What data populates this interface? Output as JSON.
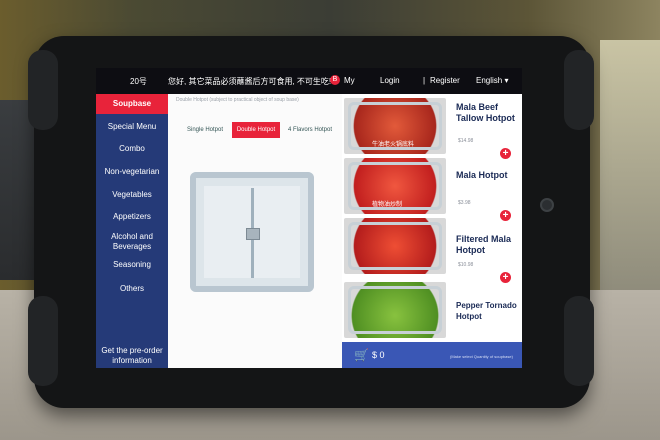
{
  "topbar": {
    "table_no": "20号",
    "notice": "您好, 其它菜品必须蘸酱后方可食用,  不可生吃!",
    "brand_letter": "B",
    "my": "My",
    "login": "Login",
    "separator": "|",
    "register": "Register",
    "language": "English ▾"
  },
  "sidebar": {
    "items": [
      {
        "label": "Soupbase"
      },
      {
        "label": "Special Menu"
      },
      {
        "label": "Combo"
      },
      {
        "label": "Non-vegetarian"
      },
      {
        "label": "Vegetables"
      },
      {
        "label": "Appetizers"
      },
      {
        "label": "Alcohol and Beverages"
      },
      {
        "label": "Seasoning"
      },
      {
        "label": "Others"
      },
      {
        "label": "Get the pre-order information"
      }
    ],
    "active_index": 0
  },
  "main": {
    "notice": "Double Hotpot (subject to practical object of soup base)",
    "tabs": [
      {
        "label": "Single Hotpot"
      },
      {
        "label": "Double Hotpot"
      },
      {
        "label": "4 Flavors Hotpot"
      }
    ],
    "active_tab": 1
  },
  "menu": {
    "items": [
      {
        "name": "Mala Beef Tallow Hotpot",
        "price": "$14.98",
        "caption": "牛油老火锅底料"
      },
      {
        "name": "Mala Hotpot",
        "price": "$3.98",
        "caption": "植物油炒制"
      },
      {
        "name": "Filtered Mala Hotpot",
        "price": "$10.98",
        "caption": ""
      },
      {
        "name": "Pepper Tornado Hotpot",
        "price": "",
        "caption": ""
      }
    ],
    "add_symbol": "+"
  },
  "cart": {
    "icon": "cart-icon",
    "total": "$ 0",
    "note": "(Make select Quantity of soupbase)"
  },
  "colors": {
    "accent": "#e8233a",
    "sidebar": "#253a78",
    "cartbar": "#3a57b5"
  }
}
